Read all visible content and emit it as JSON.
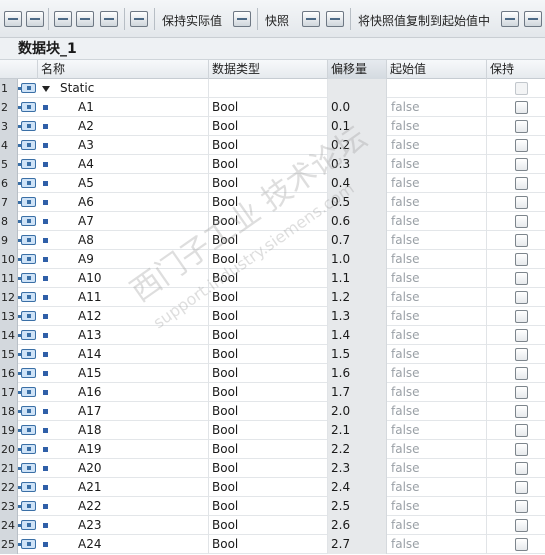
{
  "toolbar": {
    "buttons": [
      {
        "name": "insert-row-icon"
      },
      {
        "name": "add-row-icon"
      },
      {
        "name": "expand-icon"
      },
      {
        "name": "edit-icon"
      },
      {
        "name": "list-view-icon"
      },
      {
        "name": "monitor-icon"
      }
    ],
    "keep_actual_label": "保持实际值",
    "snapshot_label": "快照",
    "copy_snapshot_label": "将快照值复制到起始值中"
  },
  "block": {
    "title": "数据块_1"
  },
  "columns": {
    "name": "名称",
    "type": "数据类型",
    "offset": "偏移量",
    "start": "起始值",
    "retain": "保持"
  },
  "rows": [
    {
      "num": "1",
      "name": "Static",
      "type": "",
      "offset": "",
      "start": "",
      "root": true
    },
    {
      "num": "2",
      "name": "A1",
      "type": "Bool",
      "offset": "0.0",
      "start": "false"
    },
    {
      "num": "3",
      "name": "A2",
      "type": "Bool",
      "offset": "0.1",
      "start": "false"
    },
    {
      "num": "4",
      "name": "A3",
      "type": "Bool",
      "offset": "0.2",
      "start": "false"
    },
    {
      "num": "5",
      "name": "A4",
      "type": "Bool",
      "offset": "0.3",
      "start": "false"
    },
    {
      "num": "6",
      "name": "A5",
      "type": "Bool",
      "offset": "0.4",
      "start": "false"
    },
    {
      "num": "7",
      "name": "A6",
      "type": "Bool",
      "offset": "0.5",
      "start": "false"
    },
    {
      "num": "8",
      "name": "A7",
      "type": "Bool",
      "offset": "0.6",
      "start": "false"
    },
    {
      "num": "9",
      "name": "A8",
      "type": "Bool",
      "offset": "0.7",
      "start": "false"
    },
    {
      "num": "10",
      "name": "A9",
      "type": "Bool",
      "offset": "1.0",
      "start": "false"
    },
    {
      "num": "11",
      "name": "A10",
      "type": "Bool",
      "offset": "1.1",
      "start": "false"
    },
    {
      "num": "12",
      "name": "A11",
      "type": "Bool",
      "offset": "1.2",
      "start": "false"
    },
    {
      "num": "13",
      "name": "A12",
      "type": "Bool",
      "offset": "1.3",
      "start": "false"
    },
    {
      "num": "14",
      "name": "A13",
      "type": "Bool",
      "offset": "1.4",
      "start": "false"
    },
    {
      "num": "15",
      "name": "A14",
      "type": "Bool",
      "offset": "1.5",
      "start": "false"
    },
    {
      "num": "16",
      "name": "A15",
      "type": "Bool",
      "offset": "1.6",
      "start": "false"
    },
    {
      "num": "17",
      "name": "A16",
      "type": "Bool",
      "offset": "1.7",
      "start": "false"
    },
    {
      "num": "18",
      "name": "A17",
      "type": "Bool",
      "offset": "2.0",
      "start": "false"
    },
    {
      "num": "19",
      "name": "A18",
      "type": "Bool",
      "offset": "2.1",
      "start": "false"
    },
    {
      "num": "20",
      "name": "A19",
      "type": "Bool",
      "offset": "2.2",
      "start": "false"
    },
    {
      "num": "21",
      "name": "A20",
      "type": "Bool",
      "offset": "2.3",
      "start": "false"
    },
    {
      "num": "22",
      "name": "A21",
      "type": "Bool",
      "offset": "2.4",
      "start": "false"
    },
    {
      "num": "23",
      "name": "A22",
      "type": "Bool",
      "offset": "2.5",
      "start": "false"
    },
    {
      "num": "24",
      "name": "A23",
      "type": "Bool",
      "offset": "2.6",
      "start": "false"
    },
    {
      "num": "25",
      "name": "A24",
      "type": "Bool",
      "offset": "2.7",
      "start": "false"
    }
  ],
  "watermark": {
    "line1": "西门子工业 技术论坛",
    "line2": "support.industry.siemens.com"
  }
}
